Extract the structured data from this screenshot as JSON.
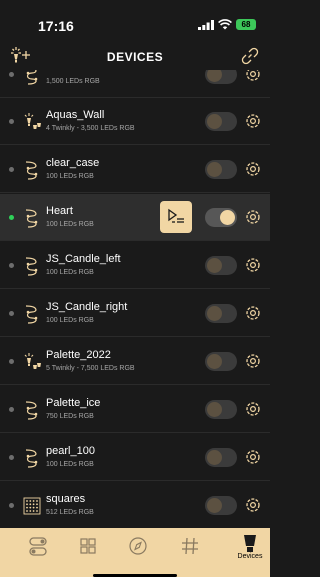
{
  "status_bar": {
    "time": "17:16",
    "battery": "68"
  },
  "header": {
    "title": "DEVICES"
  },
  "devices": [
    {
      "name": "",
      "subtitle": "1,500 LEDs RGB",
      "icon": "led-string-icon",
      "online": false,
      "on": false
    },
    {
      "name": "Aquas_Wall",
      "subtitle": "4 Twinkly - 3,500 LEDs RGB",
      "icon": "group-icon",
      "online": false,
      "on": false
    },
    {
      "name": "clear_case",
      "subtitle": "100 LEDs RGB",
      "icon": "led-string-icon",
      "online": false,
      "on": false
    },
    {
      "name": "Heart",
      "subtitle": "100 LEDs RGB",
      "icon": "led-string-icon",
      "online": true,
      "on": true
    },
    {
      "name": "JS_Candle_left",
      "subtitle": "100 LEDs RGB",
      "icon": "led-string-icon",
      "online": false,
      "on": false
    },
    {
      "name": "JS_Candle_right",
      "subtitle": "100 LEDs RGB",
      "icon": "led-string-icon",
      "online": false,
      "on": false
    },
    {
      "name": "Palette_2022",
      "subtitle": "5 Twinkly - 7,500 LEDs RGB",
      "icon": "group-icon",
      "online": false,
      "on": false
    },
    {
      "name": "Palette_ice",
      "subtitle": "750 LEDs RGB",
      "icon": "led-string-icon",
      "online": false,
      "on": false
    },
    {
      "name": "pearl_100",
      "subtitle": "100 LEDs RGB",
      "icon": "led-string-icon",
      "online": false,
      "on": false
    },
    {
      "name": "squares",
      "subtitle": "512 LEDs RGB",
      "icon": "matrix-icon",
      "online": false,
      "on": false
    }
  ],
  "tabbar": {
    "active_label": "Devices"
  },
  "colors": {
    "accent": "#f1d6a4",
    "background": "#1a1a1a",
    "online": "#2fd159",
    "battery": "#3cc759"
  }
}
